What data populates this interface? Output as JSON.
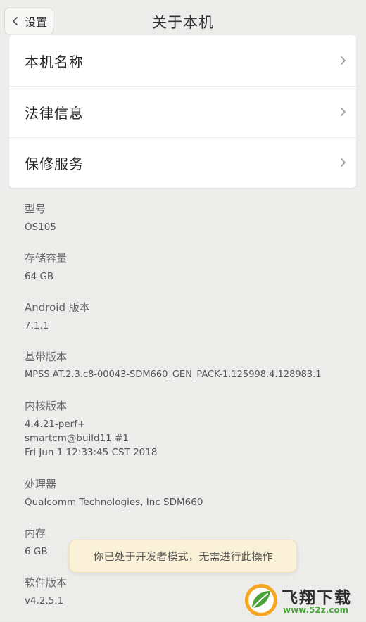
{
  "header": {
    "back_label": "设置",
    "title": "关于本机"
  },
  "card": {
    "items": [
      {
        "label": "本机名称"
      },
      {
        "label": "法律信息"
      },
      {
        "label": "保修服务"
      }
    ]
  },
  "info": [
    {
      "label": "型号",
      "value": "OS105"
    },
    {
      "label": "存储容量",
      "value": "64 GB"
    },
    {
      "label": "Android 版本",
      "value": "7.1.1"
    },
    {
      "label": "基带版本",
      "value": "MPSS.AT.2.3.c8-00043-SDM660_GEN_PACK-1.125998.4.128983.1"
    },
    {
      "label": "内核版本",
      "value_lines": [
        "4.4.21-perf+",
        "smartcm@build11 #1",
        "Fri Jun 1 12:33:45 CST 2018"
      ]
    },
    {
      "label": "处理器",
      "value": "Qualcomm Technologies, Inc SDM660"
    },
    {
      "label": "内存",
      "value": "6 GB"
    },
    {
      "label": "软件版本",
      "value": "v4.2.5.1"
    }
  ],
  "toast": {
    "message": "你已处于开发者模式，无需进行此操作"
  },
  "watermark": {
    "brand": "飞翔下载",
    "url": "www.52z.com"
  },
  "icons": {
    "back": "chevron-left-icon",
    "row": "chevron-right-icon",
    "logo": "leaf-logo-icon"
  },
  "colors": {
    "background": "#eeeeec",
    "card": "#ffffff",
    "toast_bg": "#fbf1d8",
    "watermark_green": "#4aa23a"
  }
}
